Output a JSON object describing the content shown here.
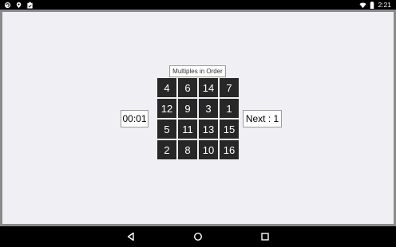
{
  "status_bar": {
    "left_icons": [
      "sync-icon",
      "location-icon",
      "clipboard-icon"
    ],
    "right_icons": [
      "wifi-icon",
      "battery-icon"
    ],
    "time": "2:21"
  },
  "game": {
    "title": "Multiples in Order",
    "timer": "00:01",
    "next_label": "Next : 1",
    "tiles": [
      "4",
      "6",
      "14",
      "7",
      "12",
      "9",
      "3",
      "1",
      "5",
      "11",
      "13",
      "15",
      "2",
      "8",
      "10",
      "16"
    ]
  },
  "nav_bar": {
    "buttons": [
      "back-icon",
      "home-icon",
      "recents-icon"
    ]
  },
  "colors": {
    "tile_bg": "#272727",
    "tile_text": "#ffffff",
    "app_bg": "#efeff4",
    "frame": "#8a8a8a"
  }
}
